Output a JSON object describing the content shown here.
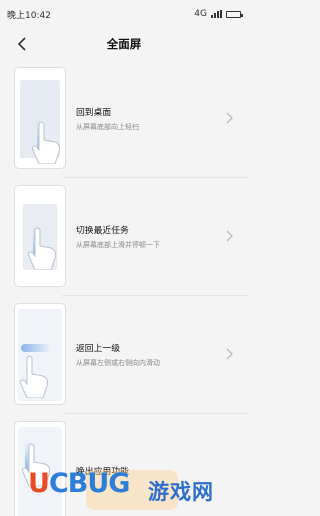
{
  "status_bar": {
    "time": "晚上10:42",
    "network": "4G"
  },
  "header": {
    "title": "全面屏"
  },
  "gestures": [
    {
      "title": "回到桌面",
      "subtitle": "从屏幕底部向上轻扫"
    },
    {
      "title": "切换最近任务",
      "subtitle": "从屏幕底部上滑并停顿一下"
    },
    {
      "title": "返回上一级",
      "subtitle": "从屏幕左侧或右侧向内滑动"
    },
    {
      "title": "唤出应用功能",
      "subtitle": ""
    }
  ],
  "watermark": {
    "brand": "UCBUG",
    "site": "游戏网",
    "site_suffix": ".com"
  },
  "colors": {
    "accent_swipe": "#78aae6",
    "brand_orange": "#e94b25",
    "brand_blue": "#2d7ed8"
  }
}
